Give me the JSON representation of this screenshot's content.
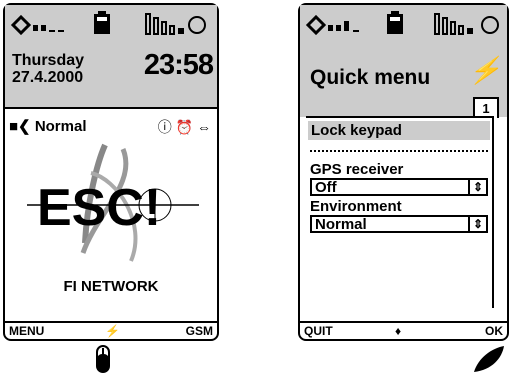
{
  "phone1": {
    "status": {
      "signal_icon": "signal-icon",
      "battery_icon": "battery-icon",
      "message_icon": "message-icon"
    },
    "day": "Thursday",
    "date": "27.4.2000",
    "time": "23:58",
    "profile": "Normal",
    "logo_text": "ESC!",
    "network_name": "FI NETWORK",
    "softkeys": {
      "left": "MENU",
      "center": "⚡",
      "right": "GSM"
    }
  },
  "phone2": {
    "title": "Quick menu",
    "tab": "1",
    "items": {
      "lock": "Lock keypad",
      "gps_label": "GPS receiver",
      "gps_value": "Off",
      "env_label": "Environment",
      "env_value": "Normal"
    },
    "softkeys": {
      "left": "QUIT",
      "center": "♦",
      "right": "OK"
    }
  },
  "colors": {
    "lcd_gray": "#cccccc",
    "ink": "#000000"
  }
}
